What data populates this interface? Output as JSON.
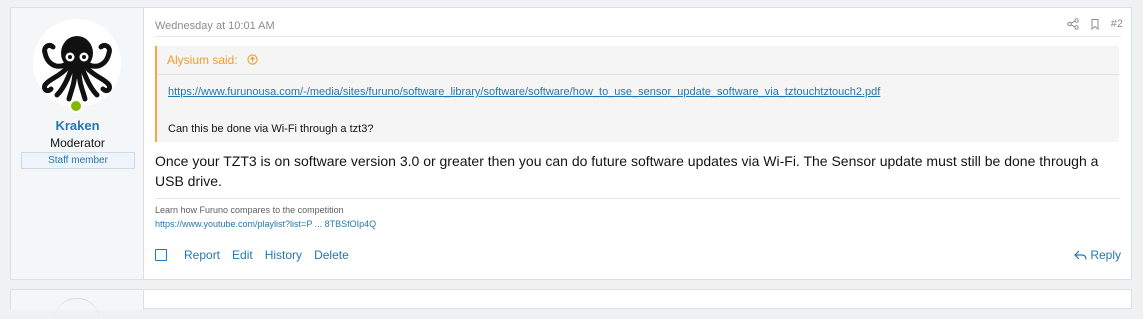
{
  "post": {
    "user": {
      "name": "Kraken",
      "title": "Moderator",
      "badge": "Staff member",
      "avatar_icon": "octopus-icon"
    },
    "date": "Wednesday at 10:01 AM",
    "post_number": "#2",
    "quote": {
      "author_label": "Alysium said:",
      "link": "https://www.furunousa.com/-/media/sites/furuno/software_library/software/software/how_to_use_sensor_update_software_via_tztouchtztouch2.pdf",
      "text": "Can this be done via Wi-Fi through a tzt3?"
    },
    "body": "Once your TZT3 is on software version 3.0 or greater then you can do future software updates via Wi-Fi. The Sensor update must still be done through a USB drive.",
    "signature": {
      "line": "Learn how Furuno compares to the competition",
      "link": "https://www.youtube.com/playlist?list=P ... 8TBSfOIp4Q"
    },
    "actions": {
      "report": "Report",
      "edit": "Edit",
      "history": "History",
      "delete": "Delete",
      "reply": "Reply"
    }
  },
  "colors": {
    "link": "#2577b1",
    "quote_accent": "#f39b2f",
    "online": "#7fb900"
  }
}
